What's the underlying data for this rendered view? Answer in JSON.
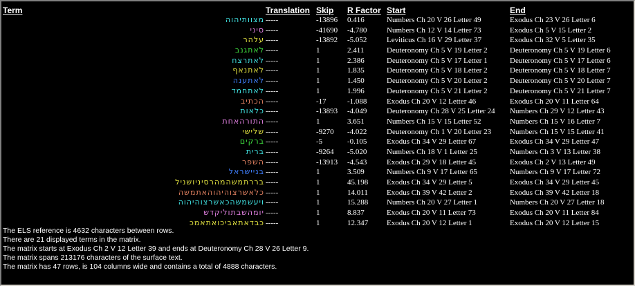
{
  "headers": {
    "term": "Term",
    "translation": "Translation",
    "skip": "Skip",
    "rfactor": "R Factor",
    "start": "Start",
    "end": "End"
  },
  "rows": [
    {
      "term": "מצוותיהוה",
      "color": "#40e0e0",
      "translation": "-----",
      "skip": "-13896",
      "rfactor": "0.416",
      "start": "Numbers Ch 20 V 26 Letter 49",
      "end": "Exodus Ch 23 V 26 Letter 6"
    },
    {
      "term": "סיני",
      "color": "#e080e0",
      "translation": "-----",
      "skip": "-41690",
      "rfactor": "-4.780",
      "start": "Numbers Ch 12 V 14 Letter 73",
      "end": "Exodus Ch 5 V 15 Letter 2"
    },
    {
      "term": "עלהר",
      "color": "#e0e040",
      "translation": "-----",
      "skip": "-13892",
      "rfactor": "-5.052",
      "start": "Leviticus Ch 16 V 29 Letter 37",
      "end": "Exodus Ch 32 V 5 Letter 35"
    },
    {
      "term": "לאתגנב",
      "color": "#40e040",
      "translation": "-----",
      "skip": "1",
      "rfactor": "2.411",
      "start": "Deuteronomy Ch 5 V 19 Letter 2",
      "end": "Deuteronomy Ch 5 V 19 Letter 6"
    },
    {
      "term": "לאתרצח",
      "color": "#40e0e0",
      "translation": "-----",
      "skip": "1",
      "rfactor": "2.386",
      "start": "Deuteronomy Ch 5 V 17 Letter 1",
      "end": "Deuteronomy Ch 5 V 17 Letter 6"
    },
    {
      "term": "לאתנאף",
      "color": "#e0e040",
      "translation": "-----",
      "skip": "1",
      "rfactor": "1.835",
      "start": "Deuteronomy Ch 5 V 18 Letter 2",
      "end": "Deuteronomy Ch 5 V 18 Letter 7"
    },
    {
      "term": "לאתענה",
      "color": "#4080ff",
      "translation": "-----",
      "skip": "1",
      "rfactor": "1.450",
      "start": "Deuteronomy Ch 5 V 20 Letter 2",
      "end": "Deuteronomy Ch 5 V 20 Letter 7"
    },
    {
      "term": "לאתחמד",
      "color": "#40e0e0",
      "translation": "-----",
      "skip": "1",
      "rfactor": "1.996",
      "start": "Deuteronomy Ch 5 V 21 Letter 2",
      "end": "Deuteronomy Ch 5 V 21 Letter 7"
    },
    {
      "term": "הכתיב",
      "color": "#e08060",
      "translation": "-----",
      "skip": "-17",
      "rfactor": "-1.088",
      "start": "Exodus Ch 20 V 12 Letter 46",
      "end": "Exodus Ch 20 V 11 Letter 64"
    },
    {
      "term": "כלאות",
      "color": "#40e0e0",
      "translation": "-----",
      "skip": "-13893",
      "rfactor": "-4.049",
      "start": "Deuteronomy Ch 28 V 25 Letter 24",
      "end": "Numbers Ch 29 V 12 Letter 43"
    },
    {
      "term": "התורהאחת",
      "color": "#e080e0",
      "translation": "-----",
      "skip": "1",
      "rfactor": "3.651",
      "start": "Numbers Ch 15 V 15 Letter 52",
      "end": "Numbers Ch 15 V 16 Letter 7"
    },
    {
      "term": "שלישי",
      "color": "#e0e040",
      "translation": "-----",
      "skip": "-9270",
      "rfactor": "-4.022",
      "start": "Deuteronomy Ch 1 V 20 Letter 23",
      "end": "Numbers Ch 15 V 15 Letter 41"
    },
    {
      "term": "ברקים",
      "color": "#40e040",
      "translation": "-----",
      "skip": "-5",
      "rfactor": "-0.105",
      "start": "Exodus Ch 34 V 29 Letter 67",
      "end": "Exodus Ch 34 V 29 Letter 47"
    },
    {
      "term": "ברית",
      "color": "#40e0e0",
      "translation": "-----",
      "skip": "-9264",
      "rfactor": "-5.020",
      "start": "Numbers Ch 18 V 1 Letter 25",
      "end": "Numbers Ch 3 V 13 Letter 38"
    },
    {
      "term": "השפר",
      "color": "#e08060",
      "translation": "-----",
      "skip": "-13913",
      "rfactor": "-4.543",
      "start": "Exodus Ch 29 V 18 Letter 45",
      "end": "Exodus Ch 2 V 13 Letter 49"
    },
    {
      "term": "בניישראל",
      "color": "#4080ff",
      "translation": "-----",
      "skip": "1",
      "rfactor": "3.509",
      "start": "Numbers Ch 9 V 17 Letter 65",
      "end": "Numbers Ch 9 V 17 Letter 72"
    },
    {
      "term": "בררתמשהמהרסיניושניל",
      "color": "#e0e040",
      "translation": "-----",
      "skip": "1",
      "rfactor": "45.198",
      "start": "Exodus Ch 34 V 29 Letter 5",
      "end": "Exodus Ch 34 V 29 Letter 45"
    },
    {
      "term": "כלאשרצוהיהוהאתמשה",
      "color": "#e08060",
      "translation": "-----",
      "skip": "1",
      "rfactor": "14.011",
      "start": "Exodus Ch 39 V 42 Letter 2",
      "end": "Exodus Ch 39 V 42 Letter 18"
    },
    {
      "term": "ויעשמשהכאשרצוהיהוה",
      "color": "#40e0e0",
      "translation": "-----",
      "skip": "1",
      "rfactor": "15.288",
      "start": "Numbers Ch 20 V 27 Letter 1",
      "end": "Numbers Ch 20 V 27 Letter 18"
    },
    {
      "term": "יומהשבתוליקדש",
      "color": "#e080e0",
      "translation": "-----",
      "skip": "1",
      "rfactor": "8.837",
      "start": "Exodus Ch 20 V 11 Letter 73",
      "end": "Exodus Ch 20 V 11 Letter 84"
    },
    {
      "term": "כבדאתאביכואתאמכ",
      "color": "#e0e040",
      "translation": "-----",
      "skip": "1",
      "rfactor": "12.347",
      "start": "Exodus Ch 20 V 12 Letter 1",
      "end": "Exodus Ch 20 V 12 Letter 15"
    }
  ],
  "info": {
    "line1": "The ELS reference is 4632 characters between rows.",
    "line2": "There are 21 displayed terms in the matrix.",
    "line3": "The matrix starts at Exodus Ch 2 V 12 Letter 39 and ends at Deuteronomy Ch 28 V 26 Letter 9.",
    "line4": "The matrix spans 213176 characters of the surface text.",
    "line5": "The matrix has 47 rows, is 104 columns wide and contains a total of 4888 characters."
  }
}
